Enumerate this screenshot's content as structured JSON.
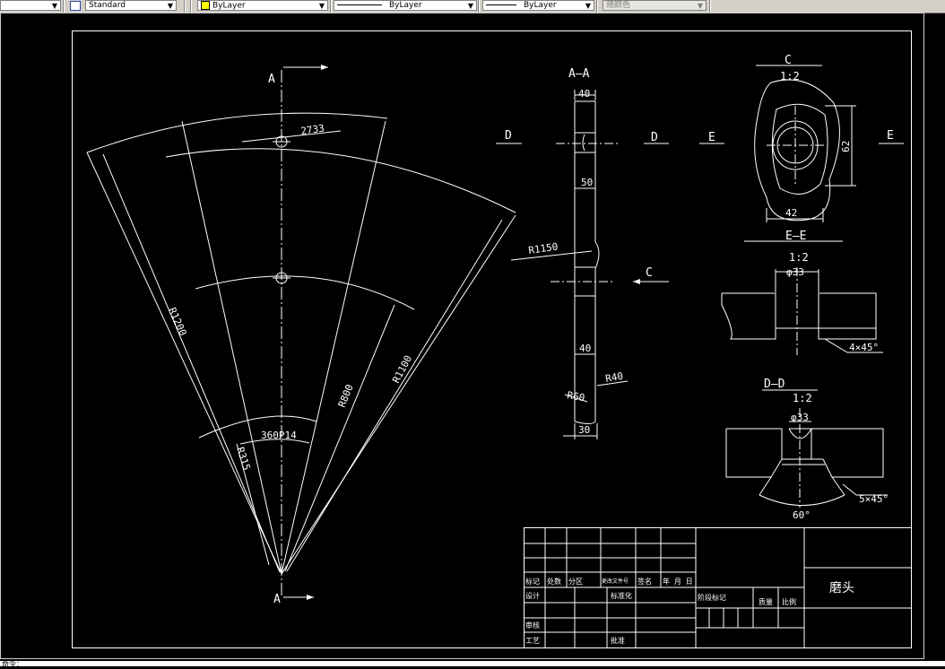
{
  "toolbar": {
    "text_style": "Standard",
    "layer": "ByLayer",
    "linetype": "ByLayer",
    "lineweight": "ByLayer",
    "plotstyle": "随颜色"
  },
  "drawing": {
    "section_aa": "A–A",
    "label_a_top": "A",
    "label_a_bottom": "A",
    "dim_2733": "2733",
    "dim_r1200": "R1200",
    "dim_r1100": "R1100",
    "dim_r800": "R800",
    "dim_r315": "R315",
    "dim_360p14": "360P14",
    "dim_40_top": "40",
    "dim_50": "50",
    "dim_r1150": "R1150",
    "dim_40_bottom": "40",
    "dim_r40": "R40",
    "dim_r60": "R60",
    "dim_30": "30",
    "label_d_left": "D",
    "label_d_right": "D",
    "label_e_left": "E",
    "label_e_right": "E",
    "label_c_arrow": "C",
    "view_c": "C",
    "scale_c": "1:2",
    "dim_42": "42",
    "dim_62": "62",
    "section_ee": "E–E",
    "scale_ee": "1:2",
    "dim_phi33_e": "φ33",
    "dim_4x45": "4×45°",
    "section_dd": "D–D",
    "scale_dd": "1:2",
    "dim_phi33_d": "φ33",
    "dim_5x45": "5×45°",
    "dim_60deg": "60°"
  },
  "title_block": {
    "mark": "标记",
    "count": "处数",
    "zone": "分区",
    "change_doc": "更改文件号",
    "signature": "签名",
    "date": "年 月 日",
    "design": "设计",
    "standardize": "标准化",
    "stage_mark": "阶段标记",
    "weight": "质量",
    "scale": "比例",
    "review": "审核",
    "process": "工艺",
    "approve": "批准",
    "part_name": "磨头"
  },
  "status_bar": {
    "text": "命令："
  }
}
